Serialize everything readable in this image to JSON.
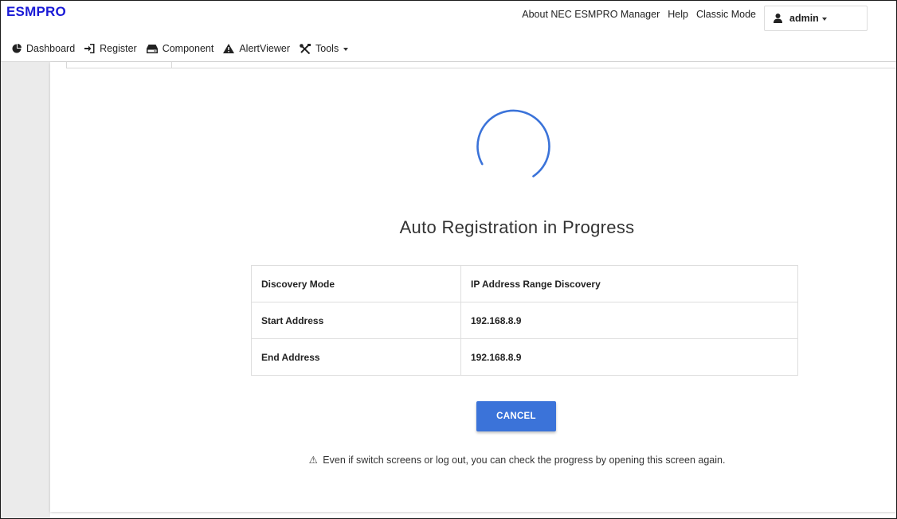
{
  "header": {
    "brand": "ESMPRO",
    "links": {
      "about": "About NEC ESMPRO Manager",
      "help": "Help",
      "classic_mode": "Classic Mode"
    },
    "user_label": "admin"
  },
  "nav": {
    "dashboard": "Dashboard",
    "register": "Register",
    "component": "Component",
    "alert_viewer": "AlertViewer",
    "tools": "Tools"
  },
  "main": {
    "title": "Auto Registration in Progress",
    "rows": [
      {
        "key": "Discovery Mode",
        "value": "IP Address Range Discovery"
      },
      {
        "key": "Start Address",
        "value": "192.168.8.9"
      },
      {
        "key": "End Address",
        "value": "192.168.8.9"
      }
    ],
    "cancel_label": "CANCEL",
    "notice_icon": "⚠",
    "notice_text": "Even if switch screens or log out, you can check the progress by opening this screen again."
  },
  "colors": {
    "brand": "#1a1ad6",
    "accent": "#3b73d9",
    "spinner": "#3b73d9"
  },
  "icons": {
    "dashboard": "pie-chart-icon",
    "register": "sign-in-icon",
    "component": "hdd-icon",
    "alert_viewer": "warning-icon",
    "tools": "tools-icon",
    "user": "user-icon"
  }
}
